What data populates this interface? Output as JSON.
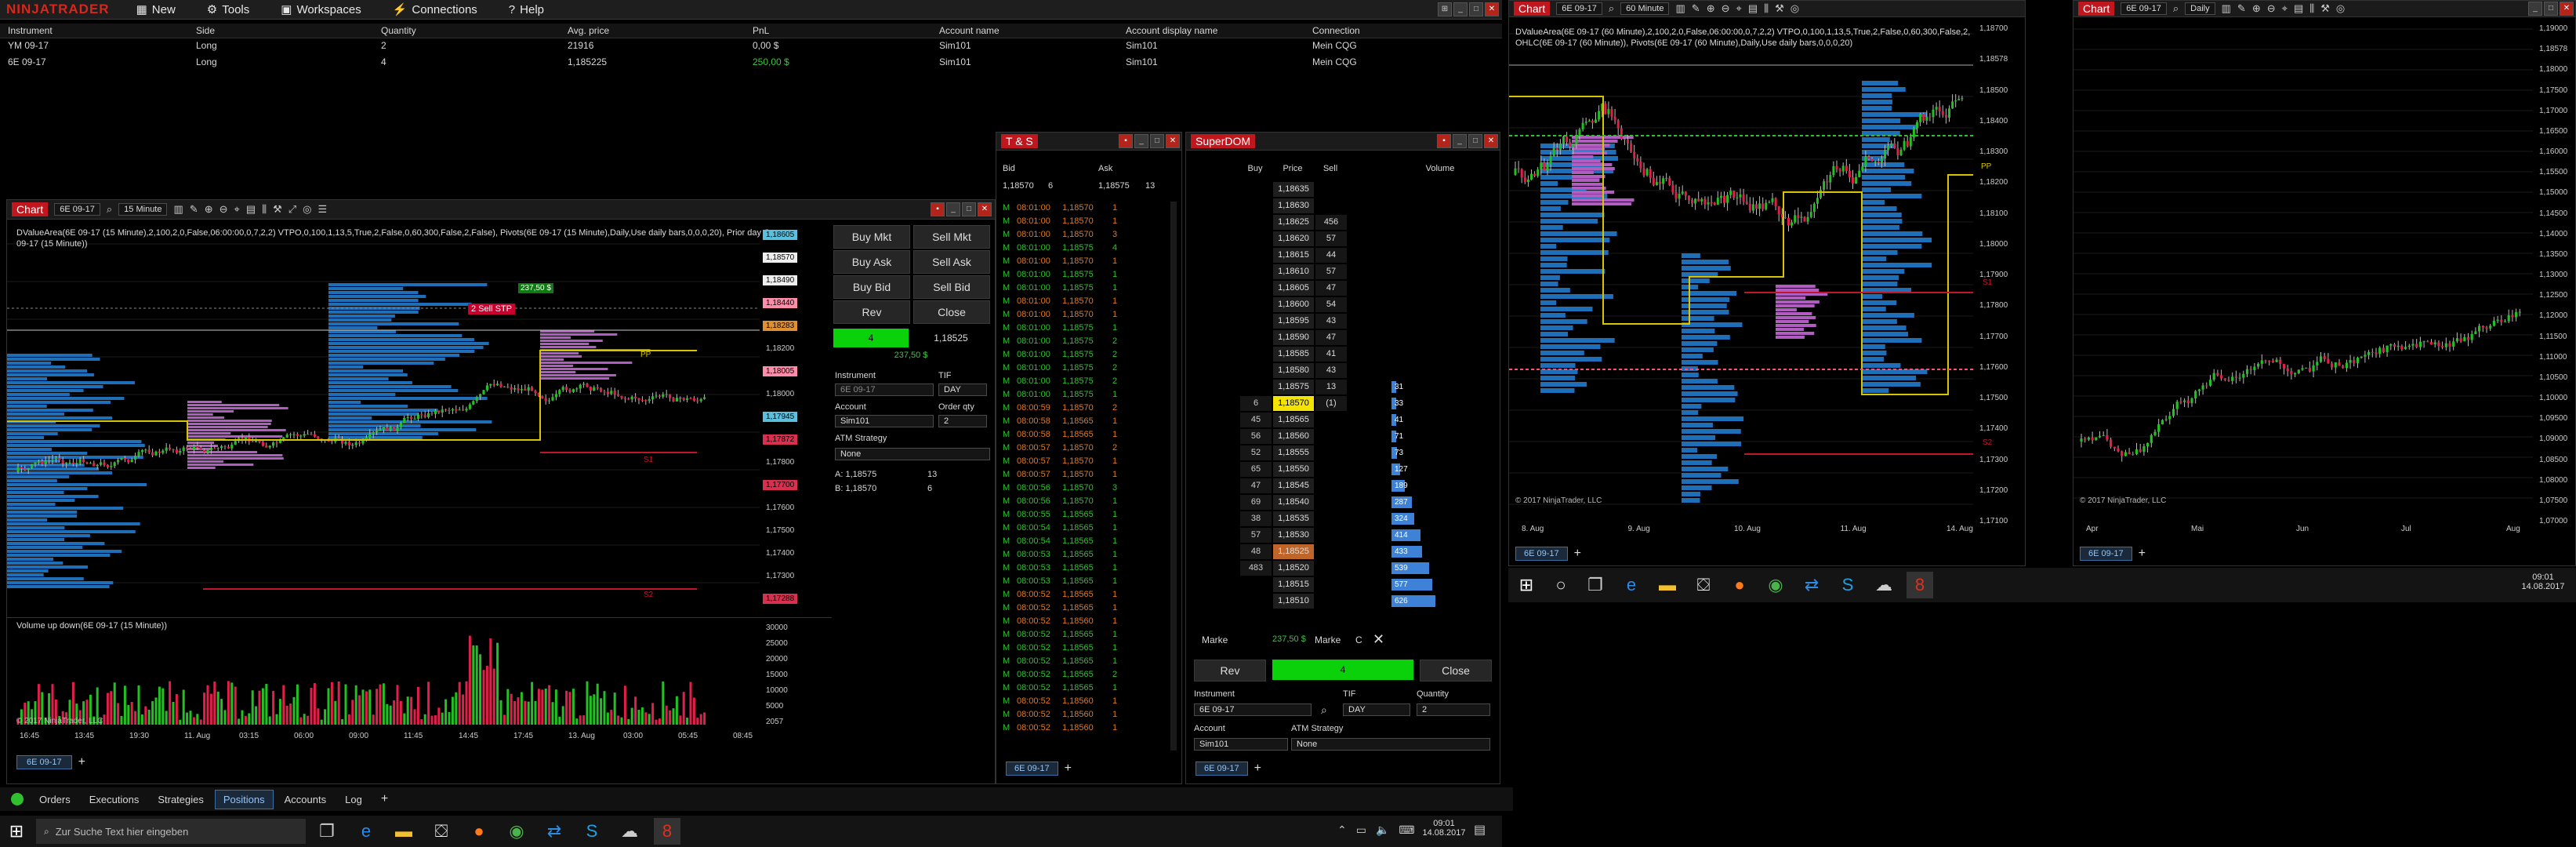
{
  "menubar": {
    "brand": "NINJATRADER",
    "items": [
      "New",
      "Tools",
      "Workspaces",
      "Connections",
      "Help"
    ]
  },
  "positions": {
    "headers": [
      "Instrument",
      "Side",
      "Quantity",
      "Avg. price",
      "PnL",
      "Account name",
      "Account display name",
      "Connection"
    ],
    "rows": [
      [
        "YM 09-17",
        "Long",
        "2",
        "21916",
        "0,00 $",
        "Sim101",
        "Sim101",
        "Mein CQG"
      ],
      [
        "6E 09-17",
        "Long",
        "4",
        "1,185225",
        "250,00 $",
        "Sim101",
        "Sim101",
        "Mein CQG"
      ]
    ]
  },
  "chart_left": {
    "label": "Chart",
    "instrument": "6E 09-17",
    "interval": "15 Minute",
    "indicator_text": "DValueArea(6E 09-17 (15 Minute),2,100,2,0,False,06:00:00,0,7,2,2) VTPO,0,100,1,13,5,True,2,False,0,60,300,False,2,False), Pivots(6E 09-17 (15 Minute),Daily,Use daily bars,0,0,0,20), Prior day OHLC",
    "indicator_text2": "09-17 (15 Minute))",
    "copyright": "© 2017 NinjaTrader, LLC",
    "volume_label": "Volume up down(6E 09-17 (15 Minute))",
    "price_labels": [
      "1,18605",
      "1,18570",
      "1,18490",
      "1,18440",
      "1,18283",
      "1,18200",
      "1,18005",
      "1,18000",
      "1,17945",
      "1,17872",
      "1,17800",
      "1,17700",
      "1,17600",
      "1,17500",
      "1,17400",
      "1,17300",
      "1,17288"
    ],
    "vol_labels": [
      "30000",
      "25000",
      "20000",
      "15000",
      "10000",
      "5000",
      "2057"
    ],
    "time_labels": [
      "16:45",
      "13:45",
      "19:30",
      "11. Aug",
      "03:15",
      "06:00",
      "09:00",
      "11:45",
      "14:45",
      "17:45",
      "13. Aug",
      "03:00",
      "05:45",
      "08:45"
    ],
    "order_tag": "2  Sell STP",
    "pnl_tag": "237,50 $",
    "pp_label": "PP",
    "s1_label": "S1",
    "s2_label": "S2",
    "tab": "6E 09-17",
    "time_marker": "03:15"
  },
  "order_panel": {
    "buy_mkt": "Buy Mkt",
    "sell_mkt": "Sell Mkt",
    "buy_ask": "Buy Ask",
    "sell_ask": "Sell Ask",
    "buy_bid": "Buy Bid",
    "sell_bid": "Sell Bid",
    "rev": "Rev",
    "close": "Close",
    "qty": "4",
    "price": "1,18525",
    "pnl": "237,50 $",
    "instrument_label": "Instrument",
    "tif_label": "TIF",
    "instrument": "6E 09-17",
    "tif": "DAY",
    "account_label": "Account",
    "qty_label": "Order qty",
    "account": "Sim101",
    "order_qty": "2",
    "atm_label": "ATM Strategy",
    "atm": "None",
    "ask_line": "A:  1,18575",
    "ask_size": "13",
    "bid_line": "B:  1,18570",
    "bid_size": "6"
  },
  "ts": {
    "title": "T & S",
    "bid_label": "Bid",
    "ask_label": "Ask",
    "bid": "1,18570",
    "bid_size": "6",
    "ask": "1,18575",
    "ask_size": "13",
    "tab": "6E 09-17",
    "rows": [
      [
        "08:01:00",
        "1,18570",
        "1",
        "o"
      ],
      [
        "08:01:00",
        "1,18570",
        "1",
        "o"
      ],
      [
        "08:01:00",
        "1,18570",
        "3",
        "o"
      ],
      [
        "08:01:00",
        "1,18575",
        "4",
        "g"
      ],
      [
        "08:01:00",
        "1,18570",
        "1",
        "o"
      ],
      [
        "08:01:00",
        "1,18575",
        "1",
        "g"
      ],
      [
        "08:01:00",
        "1,18575",
        "1",
        "g"
      ],
      [
        "08:01:00",
        "1,18570",
        "1",
        "o"
      ],
      [
        "08:01:00",
        "1,18570",
        "1",
        "o"
      ],
      [
        "08:01:00",
        "1,18575",
        "1",
        "g"
      ],
      [
        "08:01:00",
        "1,18575",
        "2",
        "g"
      ],
      [
        "08:01:00",
        "1,18575",
        "2",
        "g"
      ],
      [
        "08:01:00",
        "1,18575",
        "2",
        "g"
      ],
      [
        "08:01:00",
        "1,18575",
        "2",
        "g"
      ],
      [
        "08:01:00",
        "1,18575",
        "1",
        "g"
      ],
      [
        "08:00:59",
        "1,18570",
        "2",
        "o"
      ],
      [
        "08:00:58",
        "1,18565",
        "1",
        "o"
      ],
      [
        "08:00:58",
        "1,18565",
        "1",
        "o"
      ],
      [
        "08:00:57",
        "1,18570",
        "2",
        "o"
      ],
      [
        "08:00:57",
        "1,18570",
        "1",
        "o"
      ],
      [
        "08:00:57",
        "1,18570",
        "1",
        "o"
      ],
      [
        "08:00:56",
        "1,18570",
        "3",
        "g"
      ],
      [
        "08:00:56",
        "1,18570",
        "1",
        "g"
      ],
      [
        "08:00:55",
        "1,18565",
        "1",
        "g"
      ],
      [
        "08:00:54",
        "1,18565",
        "1",
        "g"
      ],
      [
        "08:00:54",
        "1,18565",
        "1",
        "g"
      ],
      [
        "08:00:53",
        "1,18565",
        "1",
        "g"
      ],
      [
        "08:00:53",
        "1,18565",
        "1",
        "g"
      ],
      [
        "08:00:53",
        "1,18565",
        "1",
        "g"
      ],
      [
        "08:00:52",
        "1,18565",
        "1",
        "o"
      ],
      [
        "08:00:52",
        "1,18565",
        "1",
        "o"
      ],
      [
        "08:00:52",
        "1,18560",
        "1",
        "o"
      ],
      [
        "08:00:52",
        "1,18565",
        "1",
        "g"
      ],
      [
        "08:00:52",
        "1,18565",
        "1",
        "g"
      ],
      [
        "08:00:52",
        "1,18565",
        "1",
        "g"
      ],
      [
        "08:00:52",
        "1,18565",
        "2",
        "g"
      ],
      [
        "08:00:52",
        "1,18565",
        "1",
        "g"
      ],
      [
        "08:00:52",
        "1,18560",
        "1",
        "o"
      ],
      [
        "08:00:52",
        "1,18560",
        "1",
        "o"
      ],
      [
        "08:00:52",
        "1,18560",
        "1",
        "o"
      ]
    ]
  },
  "dom": {
    "title": "SuperDOM",
    "buy_label": "Buy",
    "price_label": "Price",
    "sell_label": "Sell",
    "volume_label": "Volume",
    "rows": [
      [
        "",
        "1,18635",
        "",
        ""
      ],
      [
        "",
        "1,18630",
        "",
        ""
      ],
      [
        "",
        "1,18625",
        "456",
        ""
      ],
      [
        "",
        "1,18620",
        "57",
        ""
      ],
      [
        "",
        "1,18615",
        "44",
        ""
      ],
      [
        "",
        "1,18610",
        "57",
        ""
      ],
      [
        "",
        "1,18605",
        "47",
        ""
      ],
      [
        "",
        "1,18600",
        "54",
        ""
      ],
      [
        "",
        "1,18595",
        "43",
        ""
      ],
      [
        "",
        "1,18590",
        "47",
        ""
      ],
      [
        "",
        "1,18585",
        "41",
        ""
      ],
      [
        "",
        "1,18580",
        "43",
        ""
      ],
      [
        "",
        "1,18575",
        "13",
        "31"
      ],
      [
        "6",
        "1,18570",
        "(1)",
        "33"
      ],
      [
        "45",
        "1,18565",
        "",
        "41"
      ],
      [
        "56",
        "1,18560",
        "",
        "71"
      ],
      [
        "52",
        "1,18555",
        "",
        "73"
      ],
      [
        "65",
        "1,18550",
        "",
        "127"
      ],
      [
        "47",
        "1,18545",
        "",
        "189"
      ],
      [
        "69",
        "1,18540",
        "",
        "287"
      ],
      [
        "38",
        "1,18535",
        "",
        "324"
      ],
      [
        "57",
        "1,18530",
        "",
        "414"
      ],
      [
        "48",
        "1,18525",
        "",
        "433"
      ],
      [
        "483",
        "1,18520",
        "",
        "539"
      ],
      [
        "",
        "1,18515",
        "",
        "577"
      ],
      [
        "",
        "1,18510",
        "",
        "626"
      ]
    ],
    "market_left": "Marke",
    "market_pnl": "237,50 $",
    "market_right": "Marke",
    "c_label": "C",
    "rev": "Rev",
    "qty": "4",
    "close": "Close",
    "instrument_label": "Instrument",
    "tif_label": "TIF",
    "quantity_label": "Quantity",
    "instrument": "6E 09-17",
    "tif": "DAY",
    "quantity": "2",
    "account_label": "Account",
    "atm_label": "ATM Strategy",
    "account": "Sim101",
    "atm": "None",
    "tab": "6E 09-17"
  },
  "bottom_tabs": [
    "Orders",
    "Executions",
    "Strategies",
    "Positions",
    "Accounts",
    "Log"
  ],
  "chart_mid": {
    "label": "Chart",
    "instrument": "6E 09-17",
    "interval": "60 Minute",
    "indicator_text": "DValueArea(6E 09-17 (60 Minute),2,100,2,0,False,06:00:00,0,7,2,2) VTPO,0,100,1,13,5,True,2,False,0,60,300,False,2,False), Prior day",
    "indicator_text2": "OHLC(6E 09-17 (60 Minute)), Pivots(6E 09-17 (60 Minute),Daily,Use daily bars,0,0,0,20)",
    "copyright": "© 2017 NinjaTrader, LLC",
    "price_labels": [
      "1,18700",
      "1,18578",
      "1,18500",
      "1,18400",
      "1,18300",
      "1,18200",
      "1,18100",
      "1,18000",
      "1,17900",
      "1,17800",
      "1,17700",
      "1,17600",
      "1,17500",
      "1,17400",
      "1,17300",
      "1,17200",
      "1,17100"
    ],
    "time_labels": [
      "8. Aug",
      "9. Aug",
      "10. Aug",
      "11. Aug",
      "14. Aug"
    ],
    "tab": "6E 09-17",
    "pp_label": "PP",
    "s1_label": "S1",
    "s2_label": "S2"
  },
  "chart_right": {
    "label": "Chart",
    "instrument": "6E 09-17",
    "interval": "Daily",
    "copyright": "© 2017 NinjaTrader, LLC",
    "price_labels": [
      "1,19000",
      "1,18578",
      "1,18000",
      "1,17500",
      "1,17000",
      "1,16500",
      "1,16000",
      "1,15500",
      "1,15000",
      "1,14500",
      "1,14000",
      "1,13500",
      "1,13000",
      "1,12500",
      "1,12000",
      "1,11500",
      "1,11000",
      "1,10500",
      "1,10000",
      "1,09500",
      "1,09000",
      "1,08500",
      "1,08000",
      "1,07500",
      "1,07000"
    ],
    "time_labels": [
      "Apr",
      "Mai",
      "Jun",
      "Jul",
      "Aug"
    ],
    "tab": "6E 09-17"
  },
  "taskbar_left": {
    "search_placeholder": "Zur Suche Text hier eingeben",
    "time": "09:01",
    "date": "14.08.2017"
  },
  "taskbar_right": {
    "time": "09:01",
    "date": "14.08.2017"
  }
}
